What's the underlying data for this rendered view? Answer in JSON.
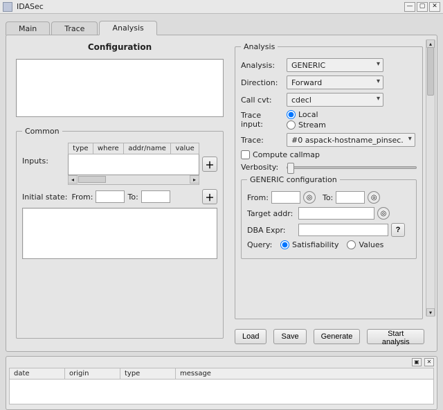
{
  "window": {
    "title": "IDASec"
  },
  "tabs": [
    "Main",
    "Trace",
    "Analysis"
  ],
  "active_tab": 2,
  "configuration": {
    "heading": "Configuration",
    "top_textbox": ""
  },
  "common": {
    "legend": "Common",
    "inputs_label": "Inputs:",
    "inputs_columns": [
      "type",
      "where",
      "addr/name",
      "value"
    ],
    "initial_state_label": "Initial state:",
    "from_label": "From:",
    "to_label": "To:",
    "from_value": "",
    "to_value": ""
  },
  "analysis": {
    "legend": "Analysis",
    "analysis_label": "Analysis:",
    "analysis_value": "GENERIC",
    "direction_label": "Direction:",
    "direction_value": "Forward",
    "callcvt_label": "Call cvt:",
    "callcvt_value": "cdecl",
    "trace_input_label": "Trace input:",
    "trace_input_options": [
      "Local",
      "Stream"
    ],
    "trace_input_selected": "Local",
    "trace_label": "Trace:",
    "trace_value": "#0 aspack-hostname_pinsec.",
    "compute_callmap_label": "Compute callmap",
    "compute_callmap_checked": false,
    "verbosity_label": "Verbosity:"
  },
  "generic": {
    "legend": "GENERIC configuration",
    "from_label": "From:",
    "from_value": "",
    "to_label": "To:",
    "to_value": "",
    "target_label": "Target addr:",
    "target_value": "",
    "dba_label": "DBA Expr:",
    "dba_value": "",
    "query_label": "Query:",
    "query_options": [
      "Satisfiability",
      "Values"
    ],
    "query_selected": "Satisfiability"
  },
  "buttons": {
    "load": "Load",
    "save": "Save",
    "generate": "Generate",
    "start": "Start analysis"
  },
  "log": {
    "columns": [
      "date",
      "origin",
      "type",
      "message"
    ]
  }
}
